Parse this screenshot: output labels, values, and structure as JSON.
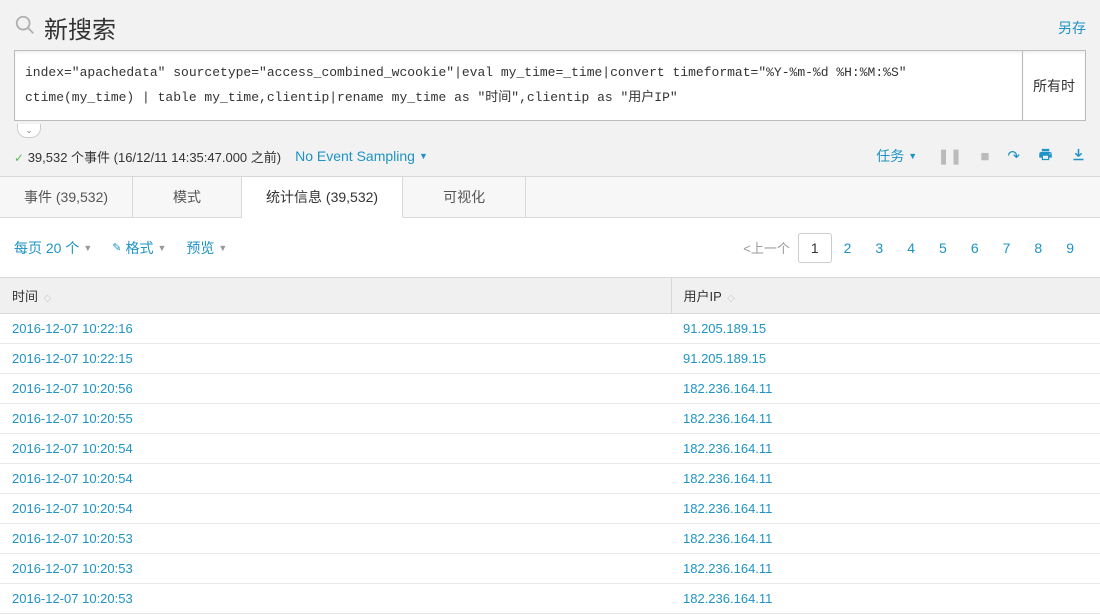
{
  "header": {
    "title": "新搜索",
    "save_link": "另存"
  },
  "search": {
    "query": "index=\"apachedata\" sourcetype=\"access_combined_wcookie\"|eval my_time=_time|convert timeformat=\"%Y-%m-%d %H:%M:%S\" ctime(my_time) | table my_time,clientip|rename my_time as \"时间\",clientip as \"用户IP\"",
    "right_button": "所有时"
  },
  "status": {
    "event_text": "39,532 个事件 (16/12/11 14:35:47.000 之前)",
    "sampling": "No Event Sampling",
    "task_menu": "任务"
  },
  "tabs": {
    "events": "事件 (39,532)",
    "patterns": "模式",
    "statistics": "统计信息 (39,532)",
    "visualization": "可视化"
  },
  "controls": {
    "per_page": "每页 20 个",
    "format": "格式",
    "preview": "预览"
  },
  "pagination": {
    "prev": "上一个",
    "pages": [
      "1",
      "2",
      "3",
      "4",
      "5",
      "6",
      "7",
      "8",
      "9"
    ]
  },
  "columns": {
    "time": "时间",
    "ip": "用户IP"
  },
  "rows": [
    {
      "time": "2016-12-07 10:22:16",
      "ip": "91.205.189.15"
    },
    {
      "time": "2016-12-07 10:22:15",
      "ip": "91.205.189.15"
    },
    {
      "time": "2016-12-07 10:20:56",
      "ip": "182.236.164.11"
    },
    {
      "time": "2016-12-07 10:20:55",
      "ip": "182.236.164.11"
    },
    {
      "time": "2016-12-07 10:20:54",
      "ip": "182.236.164.11"
    },
    {
      "time": "2016-12-07 10:20:54",
      "ip": "182.236.164.11"
    },
    {
      "time": "2016-12-07 10:20:54",
      "ip": "182.236.164.11"
    },
    {
      "time": "2016-12-07 10:20:53",
      "ip": "182.236.164.11"
    },
    {
      "time": "2016-12-07 10:20:53",
      "ip": "182.236.164.11"
    },
    {
      "time": "2016-12-07 10:20:53",
      "ip": "182.236.164.11"
    }
  ]
}
